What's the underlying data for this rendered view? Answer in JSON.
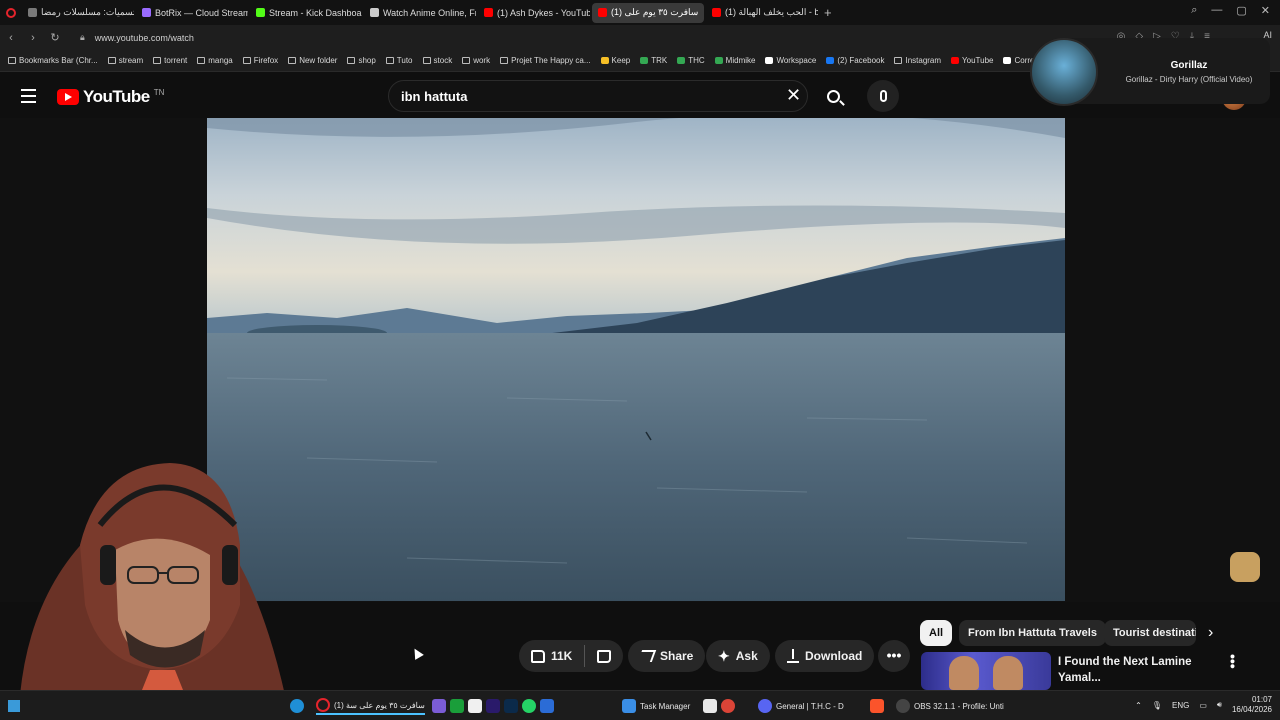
{
  "browser": {
    "tabs": [
      {
        "label": "التسميات: مسلسلات رمضا",
        "color": "#7a7a7a",
        "active": false
      },
      {
        "label": "BotRix — Cloud Streaming",
        "color": "#9a6bff",
        "active": false
      },
      {
        "label": "Stream - Kick Dashboard",
        "color": "#53fc18",
        "active": false
      },
      {
        "label": "Watch Anime Online, Free",
        "color": "#cccccc",
        "active": false
      },
      {
        "label": "(1) Ash Dykes - YouTube",
        "color": "#ff0000",
        "active": false
      },
      {
        "label": "(1) سافرت ٣٥ يوم على",
        "color": "#ff0000",
        "active": true
      },
      {
        "label": "(1) الحب يخلف الهبالة - be",
        "color": "#ff0000",
        "active": false
      }
    ],
    "new_tab": "+",
    "url": "www.youtube.com/watch",
    "ai_label": "AI"
  },
  "bookmarks": [
    {
      "label": "Bookmarks Bar (Chr...",
      "color": ""
    },
    {
      "label": "stream",
      "color": ""
    },
    {
      "label": "torrent",
      "color": ""
    },
    {
      "label": "manga",
      "color": ""
    },
    {
      "label": "Firefox",
      "color": ""
    },
    {
      "label": "New folder",
      "color": ""
    },
    {
      "label": "shop",
      "color": ""
    },
    {
      "label": "Tuto",
      "color": ""
    },
    {
      "label": "stock",
      "color": ""
    },
    {
      "label": "work",
      "color": ""
    },
    {
      "label": "Projet The Happy ca...",
      "color": ""
    },
    {
      "label": "Keep",
      "color": "#f6bf26"
    },
    {
      "label": "TRK",
      "color": "#34a853"
    },
    {
      "label": "THC",
      "color": "#34a853"
    },
    {
      "label": "Midmike",
      "color": "#34a853"
    },
    {
      "label": "Workspace",
      "color": "#ffffff"
    },
    {
      "label": "(2) Facebook",
      "color": "#1877f2"
    },
    {
      "label": "Instagram",
      "color": ""
    },
    {
      "label": "YouTube",
      "color": "#ff0000"
    },
    {
      "label": "Correcteur",
      "color": "#ffffff"
    }
  ],
  "youtube": {
    "logo_text": "YouTube",
    "region": "TN",
    "search_value": "ibn hattuta",
    "clear_icon": "close-icon"
  },
  "mini_player": {
    "title": "Gorillaz",
    "subtitle": "Gorillaz - Dirty Harry (Official Video)"
  },
  "actions": {
    "likes": "11K",
    "share": "Share",
    "ask": "Ask",
    "download": "Download",
    "ask_glyph": "✦",
    "more": "•••"
  },
  "chips": [
    {
      "label": "All",
      "active": true
    },
    {
      "label": "From Ibn Hattuta Travels",
      "active": false
    },
    {
      "label": "Tourist destinati",
      "active": false
    }
  ],
  "recommended": {
    "title": "I Found the Next Lamine Yamal..."
  },
  "taskbar": {
    "items": [
      {
        "label": "(1) سافرت ٣٥ يوم على سة",
        "color": "#e5242c"
      },
      {
        "label": "Task Manager",
        "color": "#3a8ee6"
      },
      {
        "label": "General | T.H.C - D",
        "color": "#5865f2"
      },
      {
        "label": "OBS 32.1.1 - Profile: Unti",
        "color": "#444444"
      }
    ],
    "lang": "ENG",
    "time": "01:07",
    "date": "16/04/2026"
  }
}
